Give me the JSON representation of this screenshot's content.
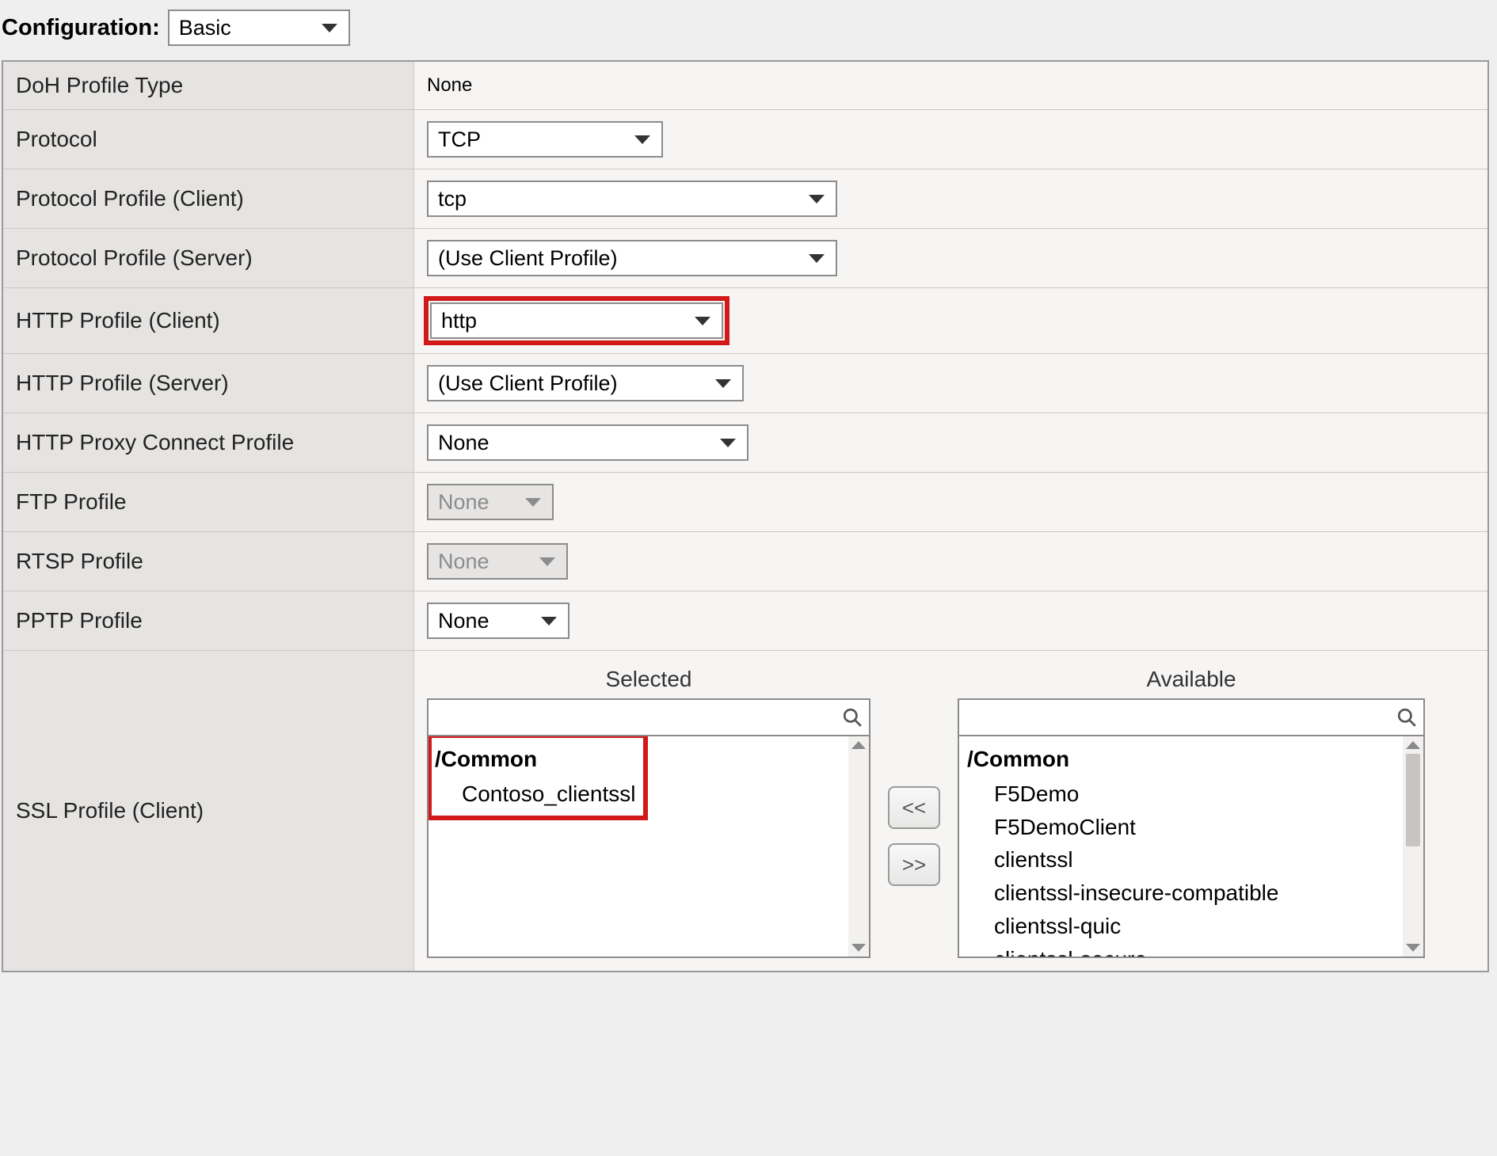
{
  "header": {
    "label": "Configuration:",
    "mode": "Basic"
  },
  "rows": {
    "doh": {
      "label": "DoH Profile Type",
      "value": "None"
    },
    "protocol": {
      "label": "Protocol",
      "value": "TCP"
    },
    "ppc": {
      "label": "Protocol Profile (Client)",
      "value": "tcp"
    },
    "pps": {
      "label": "Protocol Profile (Server)",
      "value": "(Use Client Profile)"
    },
    "httpc": {
      "label": "HTTP Profile (Client)",
      "value": "http"
    },
    "https": {
      "label": "HTTP Profile (Server)",
      "value": "(Use Client Profile)"
    },
    "proxy": {
      "label": "HTTP Proxy Connect Profile",
      "value": "None"
    },
    "ftp": {
      "label": "FTP Profile",
      "value": "None"
    },
    "rtsp": {
      "label": "RTSP Profile",
      "value": "None"
    },
    "pptp": {
      "label": "PPTP Profile",
      "value": "None"
    },
    "sslc": {
      "label": "SSL Profile (Client)"
    }
  },
  "dual": {
    "selected_title": "Selected",
    "available_title": "Available",
    "group_label": "/Common",
    "selected_items": [
      "Contoso_clientssl"
    ],
    "available_items": [
      "F5Demo",
      "F5DemoClient",
      "clientssl",
      "clientssl-insecure-compatible",
      "clientssl-quic",
      "clientssl-secure"
    ],
    "move_left": "<<",
    "move_right": ">>"
  }
}
